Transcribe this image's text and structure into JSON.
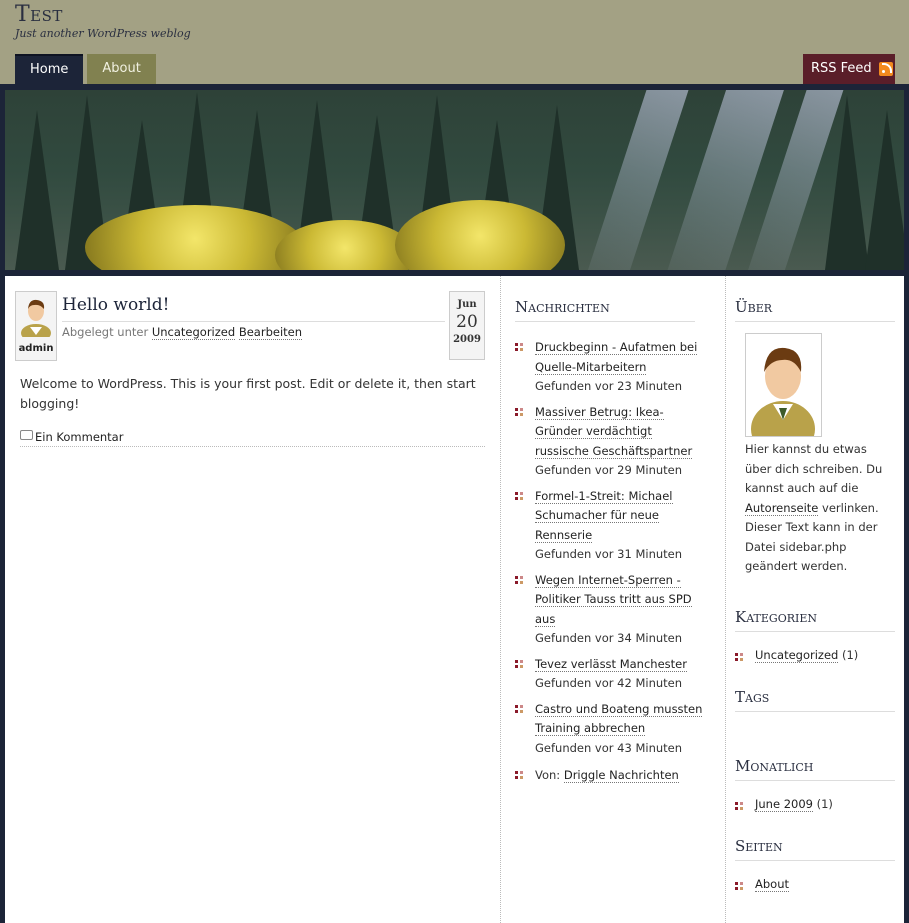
{
  "header": {
    "title": "Test",
    "description": "Just another WordPress weblog"
  },
  "nav": {
    "items": [
      {
        "label": "Home",
        "active": true
      },
      {
        "label": "About",
        "active": false
      }
    ],
    "rss_label": "RSS Feed"
  },
  "post": {
    "author": "admin",
    "title": "Hello world!",
    "meta_prefix": "Abgelegt unter",
    "category": "Uncategorized",
    "edit_label": "Bearbeiten",
    "date": {
      "month": "Jun",
      "day": "20",
      "year": "2009"
    },
    "body": "Welcome to WordPress. This is your first post. Edit or delete it, then start blogging!",
    "comment_label": "Ein Kommentar"
  },
  "news": {
    "heading": "Nachrichten",
    "items": [
      {
        "title": "Druckbeginn - Aufatmen bei Quelle-Mitarbeitern",
        "found": "Gefunden vor 23 Minuten"
      },
      {
        "title": "Massiver Betrug: Ikea-Gründer verdächtigt russische Geschäftspartner",
        "found": "Gefunden vor 29 Minuten"
      },
      {
        "title": "Formel-1-Streit: Michael Schumacher für neue Rennserie",
        "found": "Gefunden vor 31 Minuten"
      },
      {
        "title": "Wegen Internet-Sperren - Politiker Tauss tritt aus SPD aus",
        "found": "Gefunden vor 34 Minuten"
      },
      {
        "title": "Tevez verlässt Manchester",
        "found": "Gefunden vor 42 Minuten"
      },
      {
        "title": "Castro und Boateng mussten Training abbrechen",
        "found": "Gefunden vor 43 Minuten"
      }
    ],
    "source_prefix": "Von:",
    "source_link": "Driggle Nachrichten"
  },
  "sidebar": {
    "about_heading": "Über",
    "about_text_1": "Hier kannst du etwas über dich schreiben. Du kannst auch auf die",
    "about_link": "Autorenseite",
    "about_text_2": "verlinken. Dieser Text kann in der Datei sidebar.php geändert werden.",
    "categories_heading": "Kategorien",
    "category_link": "Uncategorized",
    "category_count": "(1)",
    "tags_heading": "Tags",
    "monthly_heading": "Monatlich",
    "month_link": "June 2009",
    "month_count": "(1)",
    "pages_heading": "Seiten",
    "page_link": "About"
  },
  "colors": {
    "header_bg": "#a3a184",
    "nav_active": "#1c2438",
    "nav_inactive": "#818150",
    "rss_bg": "#5a1e29",
    "accent_bullet": "#8a1a2a"
  }
}
